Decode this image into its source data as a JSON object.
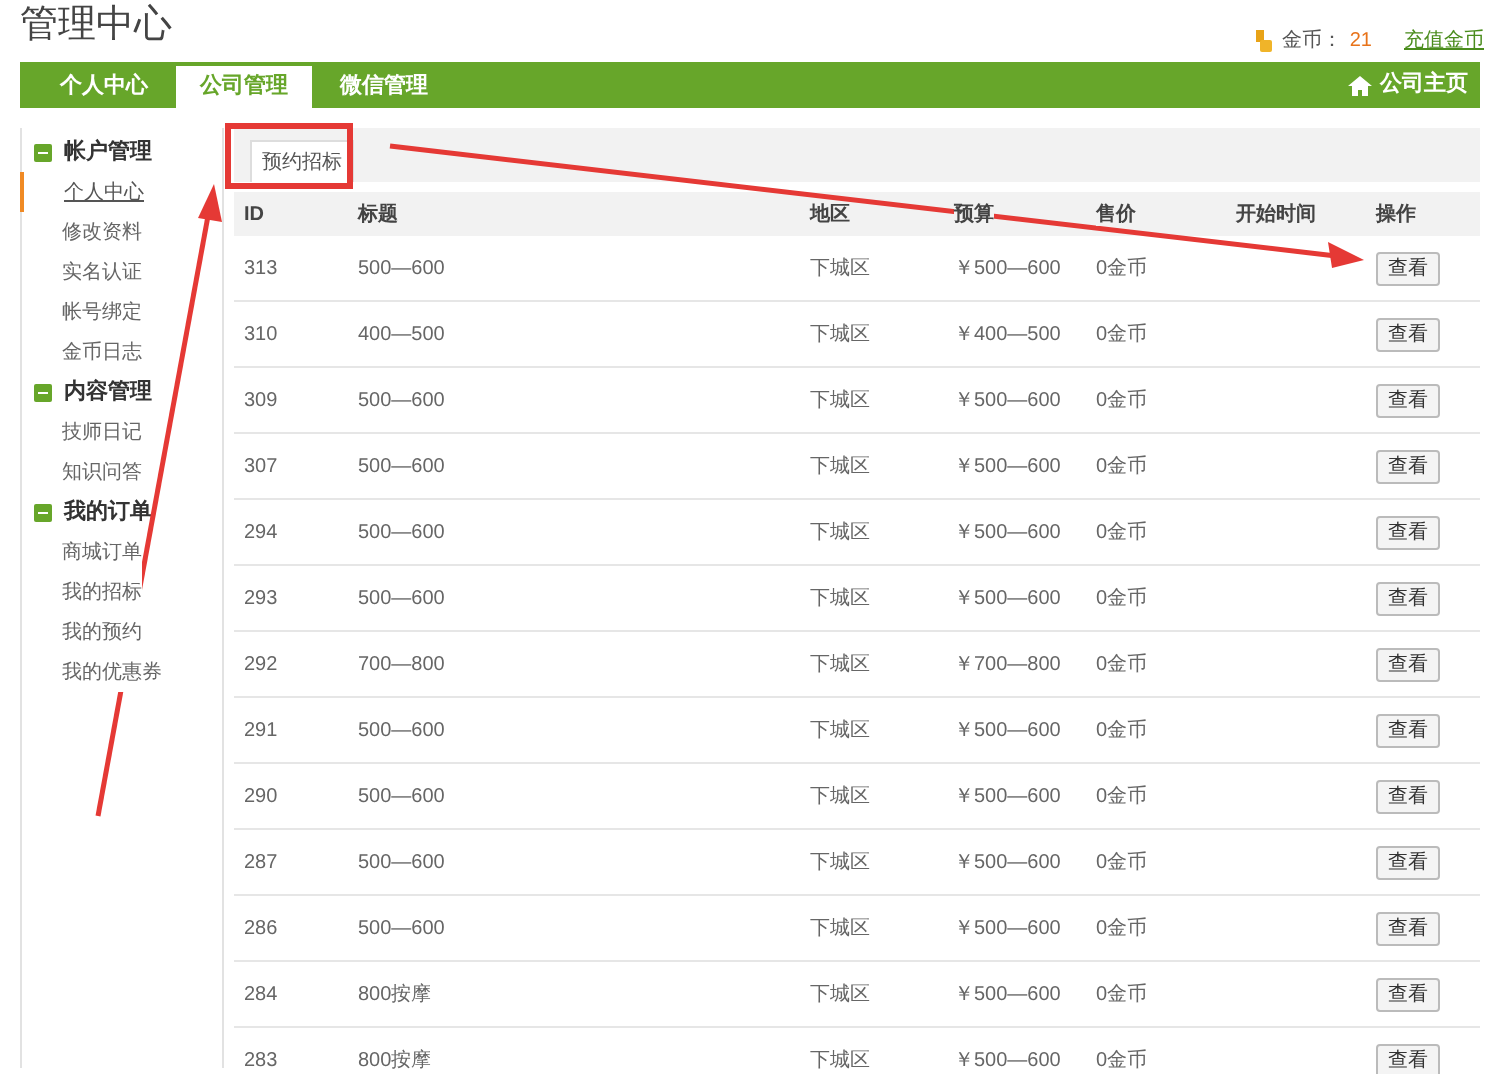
{
  "header": {
    "title": "管理中心",
    "coins_label": "金币：",
    "coins_value": "21",
    "recharge": "充值金币"
  },
  "nav": {
    "tabs": [
      {
        "label": "个人中心",
        "selected": false
      },
      {
        "label": "公司管理",
        "selected": true
      },
      {
        "label": "微信管理",
        "selected": false
      }
    ],
    "home_link": "公司主页"
  },
  "sidebar": {
    "groups": [
      {
        "title": "帐户管理",
        "items": [
          {
            "label": "个人中心",
            "selected": true
          },
          {
            "label": "修改资料",
            "selected": false
          },
          {
            "label": "实名认证",
            "selected": false
          },
          {
            "label": "帐号绑定",
            "selected": false
          },
          {
            "label": "金币日志",
            "selected": false
          }
        ]
      },
      {
        "title": "内容管理",
        "items": [
          {
            "label": "技师日记",
            "selected": false
          },
          {
            "label": "知识问答",
            "selected": false
          }
        ]
      },
      {
        "title": "我的订单",
        "items": [
          {
            "label": "商城订单",
            "selected": false
          },
          {
            "label": "我的招标",
            "selected": false
          },
          {
            "label": "我的预约",
            "selected": false
          },
          {
            "label": "我的优惠券",
            "selected": false
          }
        ]
      }
    ]
  },
  "content_tab": "预约招标",
  "table": {
    "columns": [
      "ID",
      "标题",
      "地区",
      "预算",
      "售价",
      "开始时间",
      "操作"
    ],
    "rows": [
      {
        "cells": [
          "313",
          "500—600",
          "下城区",
          "￥500—600",
          "0金币",
          ""
        ],
        "action": "查看"
      },
      {
        "cells": [
          "310",
          "400—500",
          "下城区",
          "￥400—500",
          "0金币",
          ""
        ],
        "action": "查看"
      },
      {
        "cells": [
          "309",
          "500—600",
          "下城区",
          "￥500—600",
          "0金币",
          ""
        ],
        "action": "查看"
      },
      {
        "cells": [
          "307",
          "500—600",
          "下城区",
          "￥500—600",
          "0金币",
          ""
        ],
        "action": "查看"
      },
      {
        "cells": [
          "294",
          "500—600",
          "下城区",
          "￥500—600",
          "0金币",
          ""
        ],
        "action": "查看"
      },
      {
        "cells": [
          "293",
          "500—600",
          "下城区",
          "￥500—600",
          "0金币",
          ""
        ],
        "action": "查看"
      },
      {
        "cells": [
          "292",
          "700—800",
          "下城区",
          "￥700—800",
          "0金币",
          ""
        ],
        "action": "查看"
      },
      {
        "cells": [
          "291",
          "500—600",
          "下城区",
          "￥500—600",
          "0金币",
          ""
        ],
        "action": "查看"
      },
      {
        "cells": [
          "290",
          "500—600",
          "下城区",
          "￥500—600",
          "0金币",
          ""
        ],
        "action": "查看"
      },
      {
        "cells": [
          "287",
          "500—600",
          "下城区",
          "￥500—600",
          "0金币",
          ""
        ],
        "action": "查看"
      },
      {
        "cells": [
          "286",
          "500—600",
          "下城区",
          "￥500—600",
          "0金币",
          ""
        ],
        "action": "查看"
      },
      {
        "cells": [
          "284",
          "800按摩",
          "下城区",
          "￥500—600",
          "0金币",
          ""
        ],
        "action": "查看"
      },
      {
        "cells": [
          "283",
          "800按摩",
          "下城区",
          "￥500—600",
          "0金币",
          ""
        ],
        "action": "查看"
      }
    ]
  }
}
